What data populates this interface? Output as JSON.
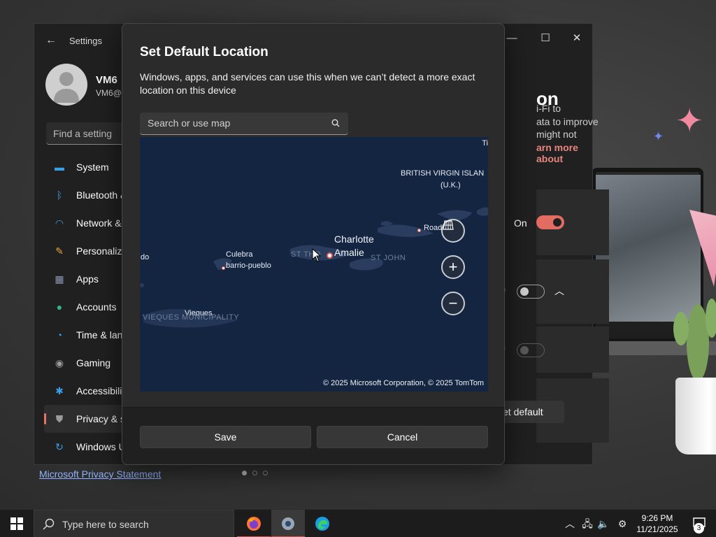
{
  "settings_window": {
    "title": "Settings",
    "profile": {
      "name": "VM6",
      "email": "VM6@c"
    },
    "find_placeholder": "Find a setting",
    "nav": [
      {
        "label": "System",
        "icon": "monitor-icon",
        "color": "#3b9fe8"
      },
      {
        "label": "Bluetooth &",
        "icon": "bluetooth-icon",
        "color": "#3b9fe8"
      },
      {
        "label": "Network &",
        "icon": "wifi-icon",
        "color": "#3b9fe8"
      },
      {
        "label": "Personaliza",
        "icon": "brush-icon",
        "color": "#e8a33b"
      },
      {
        "label": "Apps",
        "icon": "apps-icon",
        "color": "#8a9bb0"
      },
      {
        "label": "Accounts",
        "icon": "person-icon",
        "color": "#2fb58a"
      },
      {
        "label": "Time & lan",
        "icon": "globe-clock-icon",
        "color": "#3b9fe8"
      },
      {
        "label": "Gaming",
        "icon": "gamepad-icon",
        "color": "#9a9a9a"
      },
      {
        "label": "Accessibilit",
        "icon": "accessibility-icon",
        "color": "#3b9fe8"
      },
      {
        "label": "Privacy & s",
        "icon": "shield-icon",
        "color": "#9a9a9a"
      },
      {
        "label": "Windows U",
        "icon": "refresh-icon",
        "color": "#3b9fe8"
      }
    ],
    "active_nav_index": 9,
    "privacy_statement": "Microsoft Privacy Statement",
    "right_pane": {
      "heading_fragment": "on",
      "text_lines": [
        "i-Fi to",
        "ata to improve",
        "might not"
      ],
      "link_fragment": "arn more about",
      "toggle_on_label": "On",
      "f_fragment": "f",
      "set_default_fragment": "et default"
    },
    "accent_color": "#e36c62"
  },
  "dialog": {
    "title": "Set Default Location",
    "description": "Windows, apps, and services can use this when we can’t detect a more exact location on this device",
    "search_placeholder": "Search or use map",
    "map": {
      "labels": {
        "bvi": "BRITISH VIRGIN ISLAN",
        "uk": "(U.K.)",
        "charlotte": "Charlotte",
        "amalie": "Amalie",
        "st_thomas": "ST THO",
        "st_john": "ST JOHN",
        "culebra": "Culebra",
        "barrio": "barrio-pueblo",
        "vieques": "Vieques",
        "vieques_muni": "VIEQUES MUNICIPALITY",
        "road": "Road",
        "do": "do",
        "ti": "Ti"
      },
      "copyright": "© 2025 Microsoft Corporation, © 2025 TomTom"
    },
    "save_label": "Save",
    "cancel_label": "Cancel"
  },
  "taskbar": {
    "search_placeholder": "Type here to search",
    "apps": [
      "firefox-icon",
      "settings-app-icon",
      "edge-icon"
    ],
    "time": "9:26 PM",
    "date": "11/21/2025",
    "notification_count": "3"
  }
}
